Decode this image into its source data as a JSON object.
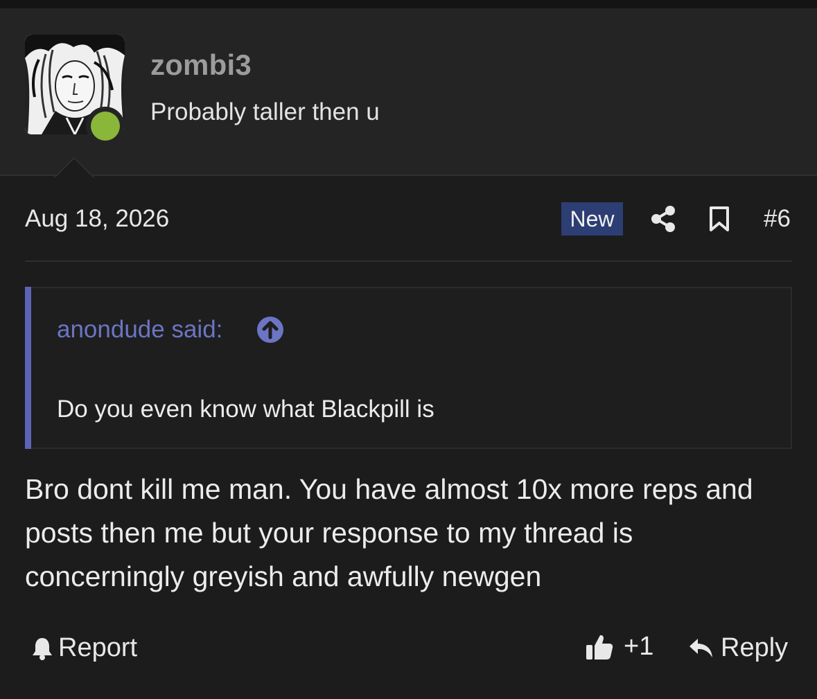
{
  "user": {
    "username": "zombi3",
    "title": "Probably taller then u",
    "status_color": "#8ab63a"
  },
  "post": {
    "date": "Aug 18, 2026",
    "badge": "New",
    "number": "#6",
    "icons": [
      "share-icon",
      "bookmark-icon"
    ],
    "body": "Bro dont kill me man. You have almost 10x more reps and posts then me but your response to my thread is concerningly greyish and awfully newgen"
  },
  "quote": {
    "author": "anondude said:",
    "text": "Do you even know what Blackpill is",
    "accent_color": "#5d63b5"
  },
  "actions": {
    "report_label": "Report",
    "like_count": "+1",
    "reply_label": "Reply"
  }
}
